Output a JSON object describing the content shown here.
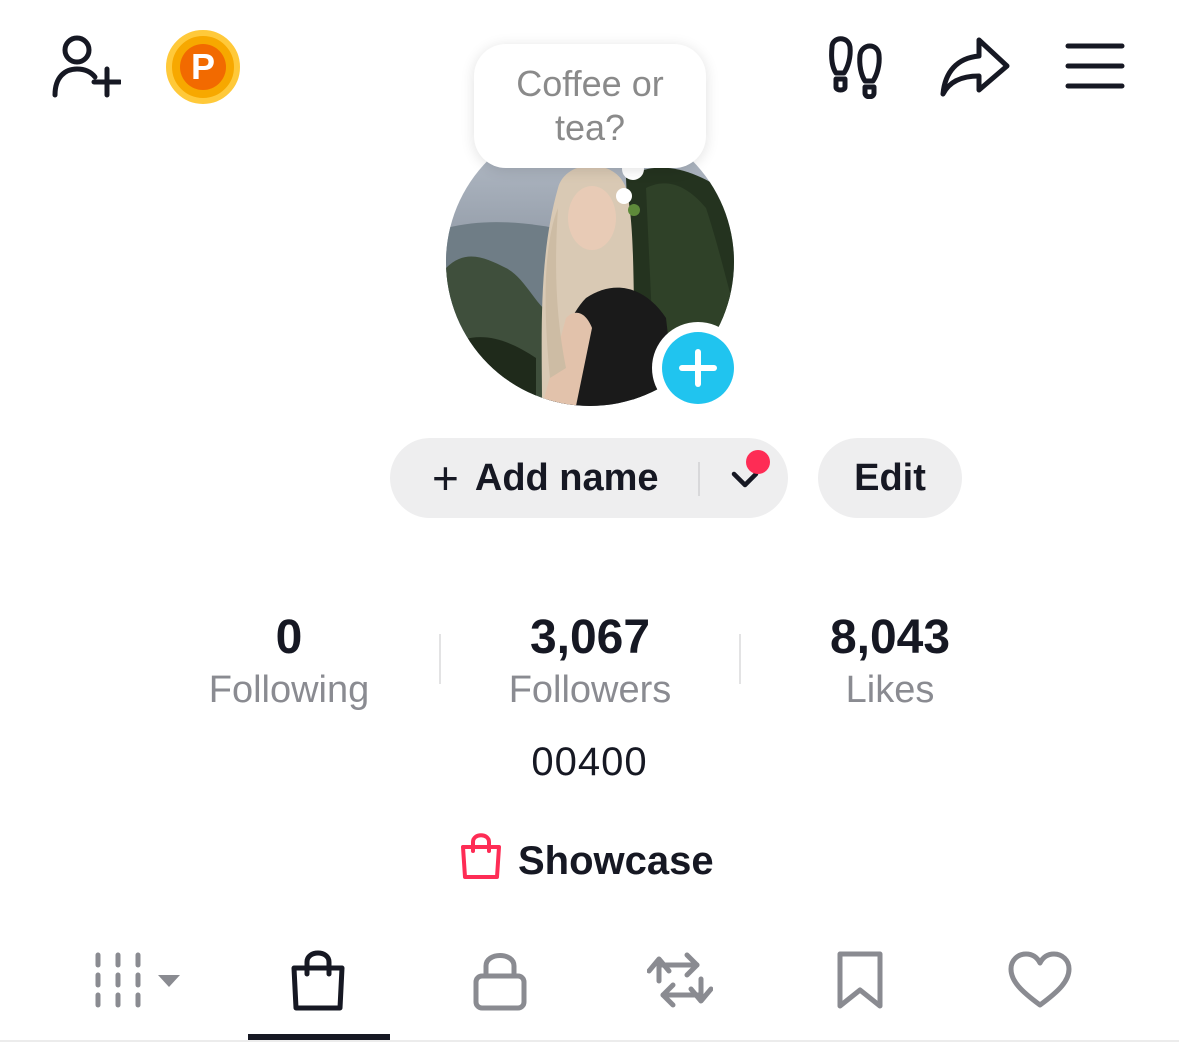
{
  "header": {
    "icons": [
      "add-friend-icon",
      "coin-icon",
      "footprints-icon",
      "share-icon",
      "menu-icon"
    ],
    "coin_letter": "P"
  },
  "bubble": {
    "line1": "Coffee or",
    "line2": "tea?"
  },
  "profile": {
    "add_name_plus": "+",
    "add_name_label": "Add name",
    "edit_label": "Edit",
    "bio": "00400"
  },
  "stats": [
    {
      "value": "0",
      "label": "Following"
    },
    {
      "value": "3,067",
      "label": "Followers"
    },
    {
      "value": "8,043",
      "label": "Likes"
    }
  ],
  "showcase": {
    "label": "Showcase"
  },
  "tabs": [
    "videos-grid-icon",
    "shop-bag-icon",
    "lock-icon",
    "repost-icon",
    "bookmark-icon",
    "heart-icon"
  ],
  "colors": {
    "accent_red": "#fe2c55",
    "avatar_plus": "#20c4ef",
    "coin": "#f7a800",
    "pill_bg": "#eeeeef",
    "muted_text": "#8a8b91"
  }
}
